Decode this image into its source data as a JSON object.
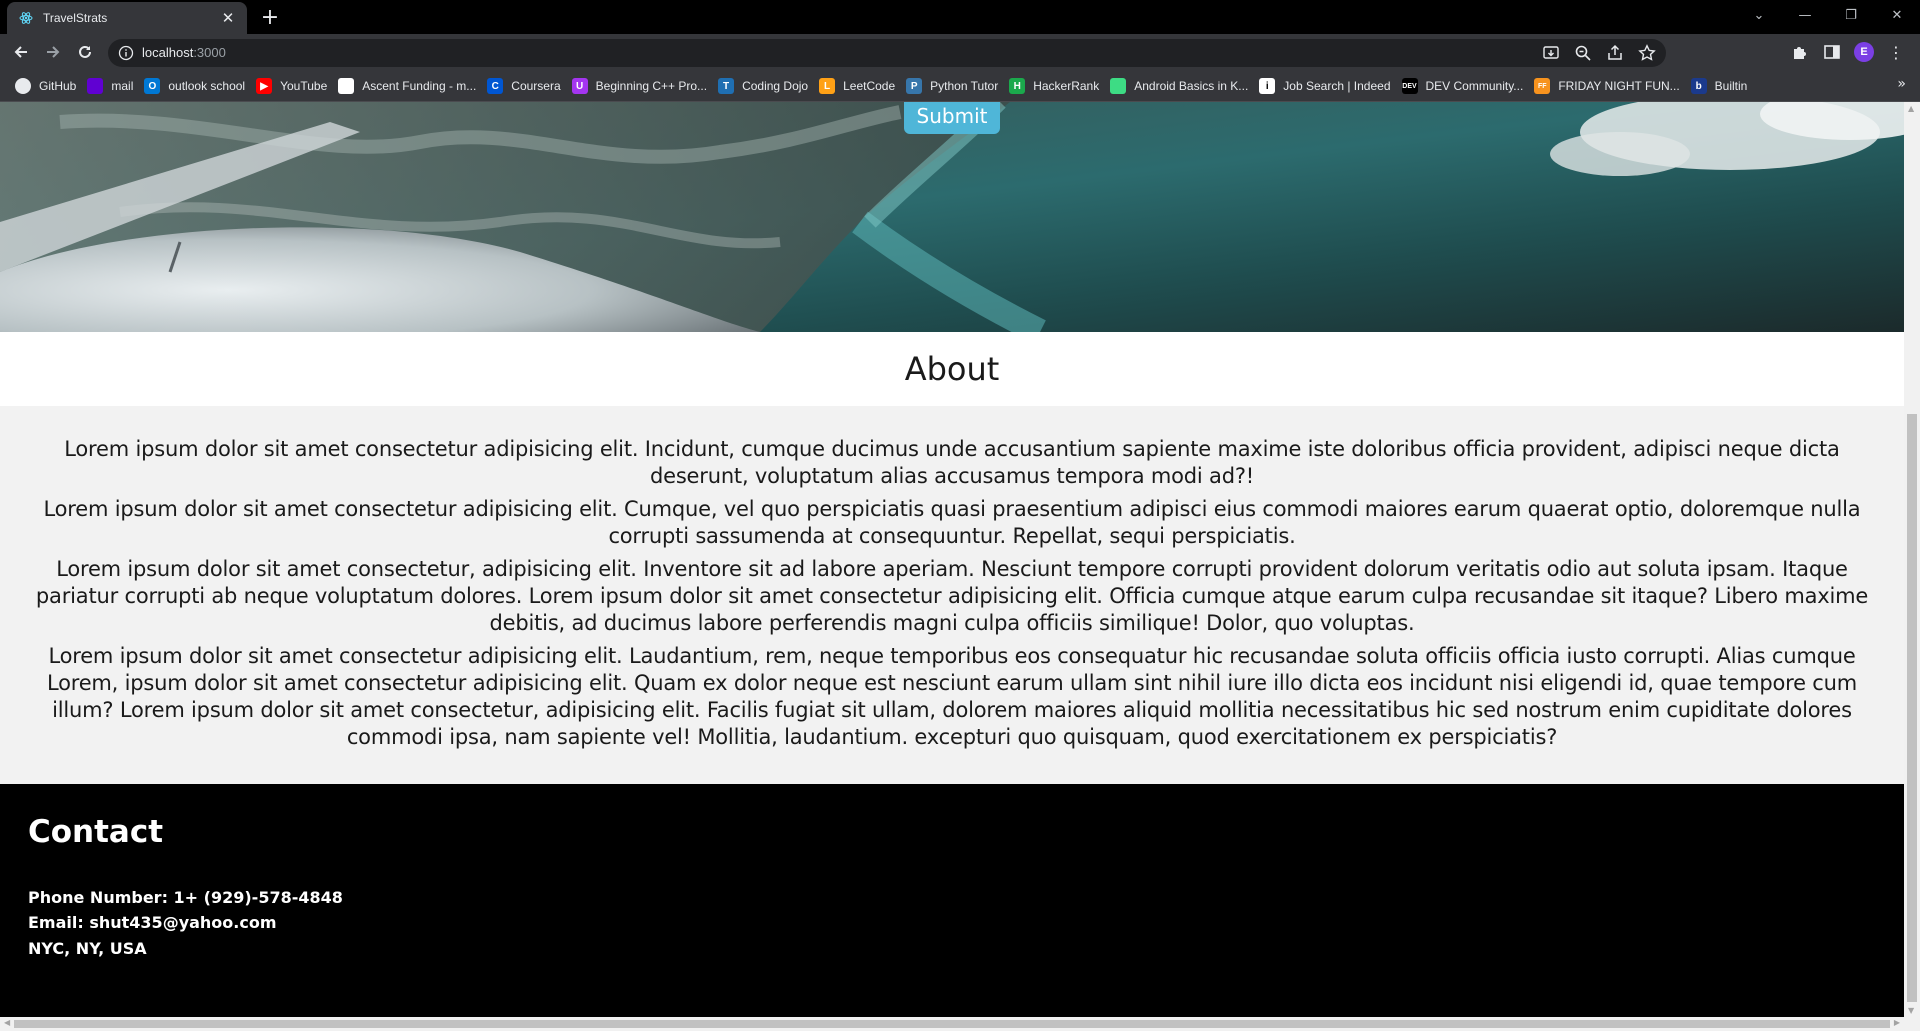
{
  "browser": {
    "tab_title": "TravelStrats",
    "url_host": "localhost",
    "url_port": ":3000",
    "bookmarks": [
      {
        "label": "GitHub",
        "icon": "github-icon",
        "color": "#000000",
        "glyph": ""
      },
      {
        "label": "mail",
        "icon": "mail-icon",
        "color": "#6001d2",
        "glyph": ""
      },
      {
        "label": "outlook school",
        "icon": "outlook-icon",
        "color": "#0078d4",
        "glyph": "O"
      },
      {
        "label": "YouTube",
        "icon": "youtube-icon",
        "color": "#ff0000",
        "glyph": "▶"
      },
      {
        "label": "Ascent Funding - m...",
        "icon": "ascent-icon",
        "color": "#ffffff",
        "glyph": ""
      },
      {
        "label": "Coursera",
        "icon": "coursera-icon",
        "color": "#0056d2",
        "glyph": "C"
      },
      {
        "label": "Beginning C++ Pro...",
        "icon": "udemy-icon",
        "color": "#a435f0",
        "glyph": "U"
      },
      {
        "label": "Coding Dojo",
        "icon": "codingdojo-icon",
        "color": "#1f6fb2",
        "glyph": "T"
      },
      {
        "label": "LeetCode",
        "icon": "leetcode-icon",
        "color": "#ffa116",
        "glyph": "L"
      },
      {
        "label": "Python Tutor",
        "icon": "python-icon",
        "color": "#3776ab",
        "glyph": "P"
      },
      {
        "label": "HackerRank",
        "icon": "hackerrank-icon",
        "color": "#1ba94c",
        "glyph": "H"
      },
      {
        "label": "Android Basics in K...",
        "icon": "android-icon",
        "color": "#3ddc84",
        "glyph": ""
      },
      {
        "label": "Job Search | Indeed",
        "icon": "indeed-icon",
        "color": "#ffffff",
        "glyph": "i"
      },
      {
        "label": "DEV Community...",
        "icon": "dev-icon",
        "color": "#000000",
        "glyph": "DEV"
      },
      {
        "label": "FRIDAY NIGHT FUN...",
        "icon": "fnf-icon",
        "color": "#f7931e",
        "glyph": "FF"
      },
      {
        "label": "Builtin",
        "icon": "builtin-icon",
        "color": "#1b3a8c",
        "glyph": "b"
      }
    ]
  },
  "page": {
    "submit_label": "Submit",
    "about": {
      "title": "About",
      "paragraphs": [
        "Lorem ipsum dolor sit amet consectetur adipisicing elit. Incidunt, cumque ducimus unde accusantium sapiente maxime iste doloribus officia provident, adipisci neque dicta deserunt, voluptatum alias accusamus tempora modi ad?!",
        "Lorem ipsum dolor sit amet consectetur adipisicing elit. Cumque, vel quo perspiciatis quasi praesentium adipisci eius commodi maiores earum quaerat optio, doloremque nulla corrupti sassumenda at consequuntur. Repellat, sequi perspiciatis.",
        "Lorem ipsum dolor sit amet consectetur, adipisicing elit. Inventore sit ad labore aperiam. Nesciunt tempore corrupti provident dolorum veritatis odio aut soluta ipsam. Itaque pariatur corrupti ab neque voluptatum dolores. Lorem ipsum dolor sit amet consectetur adipisicing elit. Officia cumque atque earum culpa recusandae sit itaque? Libero maxime debitis, ad ducimus labore perferendis magni culpa officiis similique! Dolor, quo voluptas.",
        "Lorem ipsum dolor sit amet consectetur adipisicing elit. Laudantium, rem, neque temporibus eos consequatur hic recusandae soluta officiis officia iusto corrupti. Alias cumque Lorem, ipsum dolor sit amet consectetur adipisicing elit. Quam ex dolor neque est nesciunt earum ullam sint nihil iure illo dicta eos incidunt nisi eligendi id, quae tempore cum illum? Lorem ipsum dolor sit amet consectetur, adipisicing elit. Facilis fugiat sit ullam, dolorem maiores aliquid mollitia necessitatibus hic sed nostrum enim cupiditate dolores commodi ipsa, nam sapiente vel! Mollitia, laudantium. excepturi quo quisquam, quod exercitationem ex perspiciatis?"
      ]
    },
    "contact": {
      "title": "Contact",
      "phone": "Phone Number: 1+ (929)-578-4848",
      "email": "Email: shut435@yahoo.com",
      "location": "NYC, NY, USA"
    }
  },
  "colors": {
    "submit_bg": "#4fb6d8",
    "hero_sea": "#2a6f6f",
    "hero_dark": "#1e3030"
  }
}
